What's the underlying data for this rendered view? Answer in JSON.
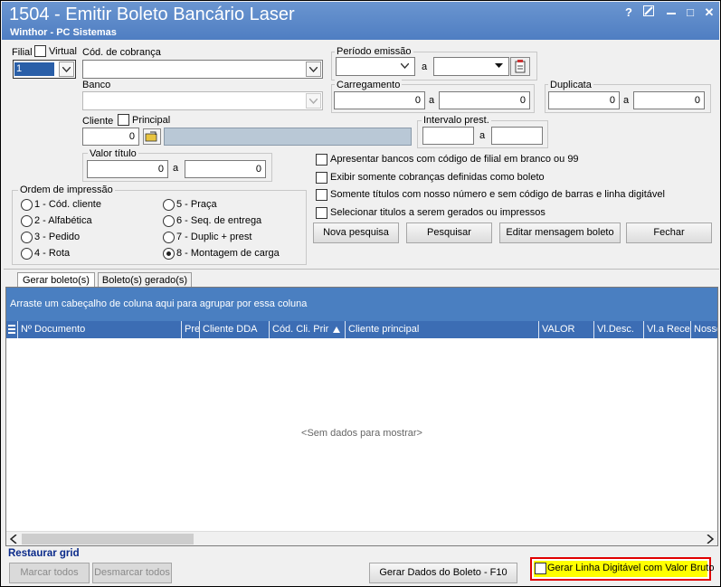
{
  "window": {
    "title": "1504 - Emitir Boleto Bancário Laser",
    "subtitle": "Winthor - PC Sistemas",
    "help_glyph": "?",
    "max_glyph": "□",
    "close_glyph": "✕"
  },
  "filters": {
    "filial_label": "Filial",
    "virtual_label": "Virtual",
    "filial_value": "1",
    "cod_cobranca_label": "Cód. de cobrança",
    "banco_label": "Banco",
    "cliente_label": "Cliente",
    "principal_label": "Principal",
    "cliente_value": "0",
    "valor_titulo_label": "Valor título",
    "valor_de": "0",
    "valor_ate": "0",
    "a_sep": "a",
    "periodo_emissao_label": "Período emissão",
    "carregamento_label": "Carregamento",
    "carreg_de": "0",
    "carreg_ate": "0",
    "duplicata_label": "Duplicata",
    "dup_de": "0",
    "dup_ate": "0",
    "intervalo_label": "Intervalo prest."
  },
  "ordem": {
    "label": "Ordem de impressão",
    "options": [
      "1 - Cód. cliente",
      "2 - Alfabética",
      "3 - Pedido",
      "4 - Rota",
      "5 - Praça",
      "6 - Seq. de entrega",
      "7 - Duplic + prest",
      "8 - Montagem de carga"
    ],
    "selected": "8 - Montagem de carga"
  },
  "options": [
    "Apresentar bancos com código de filial em branco ou 99",
    "Exibir somente cobranças definidas como boleto",
    "Somente títulos com nosso número e sem código de barras e linha digitável",
    "Selecionar titulos a serem gerados ou impressos"
  ],
  "actions": {
    "nova_pesquisa": "Nova pesquisa",
    "pesquisar": "Pesquisar",
    "editar_mensagem": "Editar mensagem boleto",
    "fechar": "Fechar"
  },
  "tabs": [
    "Gerar boleto(s)",
    "Boleto(s) gerado(s)"
  ],
  "grid": {
    "group_hint": "Arraste um cabeçalho de coluna aqui para agrupar por essa coluna",
    "columns": [
      "Nº Documento",
      "Pre",
      "Cliente DDA",
      "Cód. Cli. Prir",
      "Cliente principal",
      "VALOR",
      "Vl.Desc.",
      "Vl.a Receb",
      "NossoN"
    ],
    "empty": "<Sem dados para mostrar>"
  },
  "footer": {
    "restaurar_grid": "Restaurar grid",
    "marcar_todos": "Marcar todos",
    "desmarcar_todos": "Desmarcar todos",
    "gerar_dados": "Gerar Dados do Boleto - F10",
    "gerar_linha": "Gerar Linha Digitável com Valor Bruto"
  },
  "colors": {
    "title_bar": "#5a89c9",
    "grid_header": "#3c6db4",
    "highlight": "#ffff00",
    "highlight_border": "#e00000",
    "link": "#0a2a8a"
  }
}
